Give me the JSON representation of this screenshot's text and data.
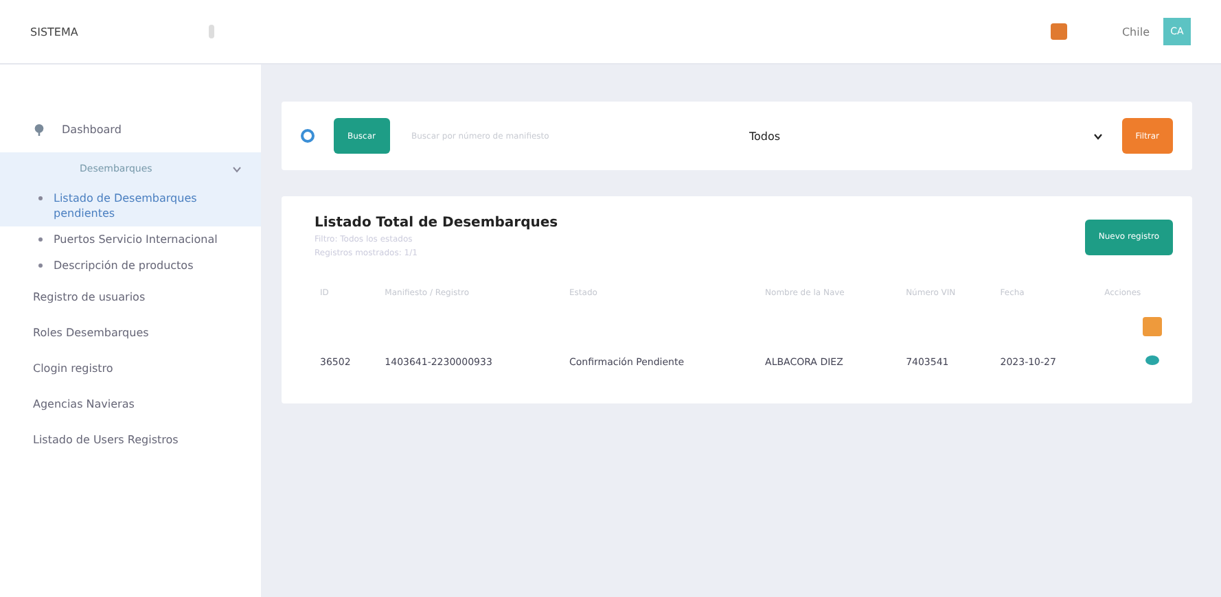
{
  "brand": "SISTEMA",
  "header": {
    "user": "Chile",
    "avatar": "CA"
  },
  "sidebar": {
    "items": [
      {
        "label": "Dashboard",
        "kind": "icon"
      },
      {
        "label": "Desembarques",
        "kind": "group",
        "expanded": true,
        "children": [
          {
            "label": "Listado de Desembarques pendientes",
            "selected": true
          },
          {
            "label": "Puertos Servicio Internacional",
            "selected": false
          },
          {
            "label": "Descripción de productos",
            "selected": false
          }
        ]
      },
      {
        "label": "Registro de usuarios",
        "kind": "plain"
      },
      {
        "label": "Roles Desembarques",
        "kind": "plain"
      },
      {
        "label": "Clogin registro",
        "kind": "plain"
      },
      {
        "label": "Agencias Navieras",
        "kind": "plain"
      },
      {
        "label": "Listado de Users Registros",
        "kind": "plain"
      }
    ]
  },
  "filter": {
    "search_button": "Buscar",
    "placeholder": "Buscar por número de manifiesto",
    "select": "Todos",
    "filter_button": "Filtrar"
  },
  "list": {
    "title": "Listado Total de Desembarques",
    "subtitles": [
      "Filtro: Todos los estados",
      "Registros mostrados: 1/1"
    ],
    "new_button": "Nuevo registro",
    "columns": [
      "ID",
      "Manifiesto / Registro",
      "Estado",
      "Nombre de la Nave",
      "Número VIN",
      "Fecha",
      "Acciones"
    ],
    "rows": [
      {
        "cells": [
          "36502",
          "1403641-2230000933",
          "Confirmación Pendiente",
          "ALBACORA DIEZ",
          "7403541",
          "2023-10-27"
        ]
      }
    ]
  }
}
